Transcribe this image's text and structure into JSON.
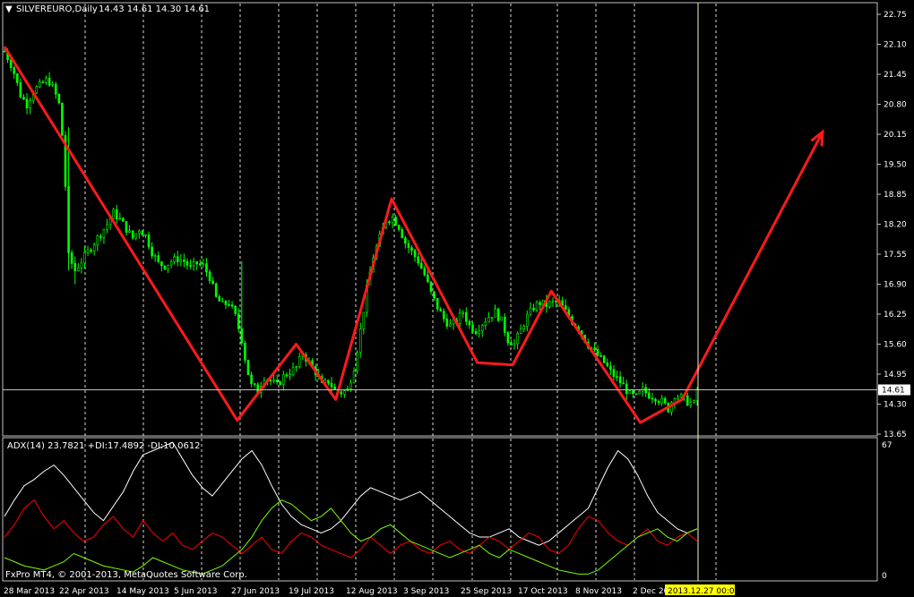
{
  "chart_data": [
    {
      "type": "candlestick",
      "symbol_label": "SILVEREURO,Daily",
      "ohlc_label": "14.43 14.61 14.30 14.61",
      "ylim": [
        13.65,
        22.75
      ],
      "y_ticks": [
        "22.75",
        "22.10",
        "21.45",
        "20.80",
        "20.15",
        "19.50",
        "18.85",
        "18.20",
        "17.55",
        "16.90",
        "16.25",
        "15.60",
        "14.95",
        "14.30",
        "13.65"
      ],
      "current_price": "14.61",
      "x_labels": [
        "28 Mar 2013",
        "22 Apr 2013",
        "14 May 2013",
        "5 Jun 2013",
        "27 Jun 2013",
        "19 Jul 2013",
        "12 Aug 2013",
        "3 Sep 2013",
        "25 Sep 2013",
        "17 Oct 2013",
        "8 Nov 2013",
        "2 Dec 2013"
      ],
      "cursor_label": "2013.12.27 00:00",
      "price_path": [
        [
          0,
          21.95
        ],
        [
          5,
          21.6
        ],
        [
          10,
          21.0
        ],
        [
          14,
          20.8
        ],
        [
          18,
          21.1
        ],
        [
          22,
          21.2
        ],
        [
          27,
          21.35
        ],
        [
          31,
          21.1
        ],
        [
          34,
          20.8
        ],
        [
          37,
          19.8
        ],
        [
          40,
          17.5
        ],
        [
          44,
          17.2
        ],
        [
          48,
          17.4
        ],
        [
          52,
          17.6
        ],
        [
          56,
          17.8
        ],
        [
          60,
          18.0
        ],
        [
          64,
          18.2
        ],
        [
          68,
          18.45
        ],
        [
          72,
          18.3
        ],
        [
          76,
          18.1
        ],
        [
          80,
          17.9
        ],
        [
          84,
          18.1
        ],
        [
          88,
          17.95
        ],
        [
          92,
          17.6
        ],
        [
          96,
          17.35
        ],
        [
          100,
          17.3
        ],
        [
          104,
          17.4
        ],
        [
          108,
          17.45
        ],
        [
          112,
          17.4
        ],
        [
          116,
          17.25
        ],
        [
          120,
          17.35
        ],
        [
          124,
          17.3
        ],
        [
          128,
          17.05
        ],
        [
          132,
          16.6
        ],
        [
          136,
          16.45
        ],
        [
          140,
          16.5
        ],
        [
          144,
          16.2
        ],
        [
          148,
          15.7
        ],
        [
          151,
          15.1
        ],
        [
          154,
          14.7
        ],
        [
          158,
          14.6
        ],
        [
          162,
          14.9
        ],
        [
          166,
          14.8
        ],
        [
          170,
          14.7
        ],
        [
          174,
          14.9
        ],
        [
          178,
          15.0
        ],
        [
          182,
          15.1
        ],
        [
          186,
          15.4
        ],
        [
          190,
          15.2
        ],
        [
          194,
          15.0
        ],
        [
          198,
          14.7
        ],
        [
          202,
          14.8
        ],
        [
          206,
          14.6
        ],
        [
          210,
          14.55
        ],
        [
          214,
          14.6
        ],
        [
          218,
          15.1
        ],
        [
          222,
          15.9
        ],
        [
          226,
          16.8
        ],
        [
          230,
          17.5
        ],
        [
          234,
          17.9
        ],
        [
          238,
          18.3
        ],
        [
          242,
          18.35
        ],
        [
          246,
          18.15
        ],
        [
          250,
          17.8
        ],
        [
          254,
          17.6
        ],
        [
          258,
          17.4
        ],
        [
          262,
          17.1
        ],
        [
          266,
          16.7
        ],
        [
          270,
          16.4
        ],
        [
          274,
          16.15
        ],
        [
          278,
          16.0
        ],
        [
          282,
          16.1
        ],
        [
          286,
          16.3
        ],
        [
          290,
          16.0
        ],
        [
          294,
          15.9
        ],
        [
          298,
          16.05
        ],
        [
          302,
          16.2
        ],
        [
          306,
          16.3
        ],
        [
          310,
          16.1
        ],
        [
          314,
          15.7
        ],
        [
          318,
          15.6
        ],
        [
          322,
          15.9
        ],
        [
          326,
          16.2
        ],
        [
          330,
          16.4
        ],
        [
          334,
          16.5
        ],
        [
          338,
          16.45
        ],
        [
          342,
          16.5
        ],
        [
          346,
          16.5
        ],
        [
          350,
          16.3
        ],
        [
          354,
          16.1
        ],
        [
          358,
          15.95
        ],
        [
          362,
          15.7
        ],
        [
          366,
          15.5
        ],
        [
          370,
          15.35
        ],
        [
          374,
          15.2
        ],
        [
          378,
          15.0
        ],
        [
          382,
          14.85
        ],
        [
          386,
          14.7
        ],
        [
          390,
          14.5
        ],
        [
          394,
          14.45
        ],
        [
          398,
          14.6
        ],
        [
          402,
          14.5
        ],
        [
          406,
          14.45
        ],
        [
          410,
          14.35
        ],
        [
          414,
          14.2
        ],
        [
          418,
          14.5
        ],
        [
          422,
          14.45
        ],
        [
          426,
          14.35
        ],
        [
          430,
          14.3
        ],
        [
          432,
          14.61
        ]
      ],
      "price_path_x_range": [
        0,
        432
      ],
      "zigzag": [
        [
          0,
          22.05
        ],
        [
          217,
          13.95
        ],
        [
          272,
          15.6
        ],
        [
          309,
          14.4
        ],
        [
          361,
          18.75
        ],
        [
          441,
          15.2
        ],
        [
          474,
          15.15
        ],
        [
          510,
          16.75
        ],
        [
          593,
          13.9
        ],
        [
          632,
          14.4
        ],
        [
          763,
          20.2
        ]
      ],
      "zigzag_x_range": [
        0,
        763
      ]
    },
    {
      "type": "line",
      "label": "ADX(14) 23.7821 +DI:17.4892 -DI:10.0612",
      "ylim": [
        0,
        67
      ],
      "y_ticks": [
        "67",
        "0"
      ],
      "series": [
        {
          "color": "#ffffff",
          "values": [
            30,
            38,
            45,
            48,
            52,
            55,
            50,
            44,
            38,
            32,
            28,
            35,
            42,
            52,
            60,
            62,
            64,
            66,
            58,
            50,
            44,
            40,
            46,
            52,
            58,
            62,
            55,
            45,
            36,
            30,
            26,
            24,
            22,
            24,
            28,
            34,
            40,
            44,
            42,
            40,
            38,
            40,
            42,
            38,
            34,
            30,
            26,
            22,
            20,
            20,
            22,
            24,
            20,
            18,
            16,
            18,
            22,
            26,
            30,
            34,
            44,
            54,
            62,
            58,
            50,
            40,
            32,
            28,
            24,
            22,
            24
          ]
        },
        {
          "color": "#ff0000",
          "values": [
            20,
            26,
            34,
            38,
            30,
            24,
            28,
            22,
            18,
            20,
            26,
            30,
            24,
            20,
            28,
            22,
            18,
            22,
            16,
            14,
            18,
            22,
            20,
            16,
            12,
            16,
            20,
            14,
            12,
            18,
            22,
            20,
            16,
            14,
            12,
            10,
            14,
            20,
            16,
            12,
            16,
            18,
            14,
            12,
            16,
            18,
            14,
            12,
            16,
            20,
            18,
            14,
            18,
            22,
            20,
            14,
            12,
            16,
            24,
            30,
            28,
            22,
            18,
            16,
            20,
            24,
            18,
            16,
            20,
            22,
            18
          ]
        },
        {
          "color": "#7cfc00",
          "values": [
            10,
            8,
            6,
            5,
            4,
            6,
            8,
            12,
            10,
            8,
            6,
            5,
            4,
            3,
            6,
            10,
            8,
            6,
            4,
            3,
            2,
            4,
            6,
            10,
            14,
            20,
            28,
            34,
            38,
            36,
            32,
            28,
            30,
            34,
            28,
            22,
            18,
            20,
            24,
            26,
            22,
            18,
            16,
            14,
            12,
            10,
            12,
            14,
            16,
            12,
            10,
            14,
            12,
            10,
            8,
            6,
            4,
            3,
            2,
            2,
            4,
            8,
            12,
            16,
            20,
            22,
            24,
            20,
            18,
            22,
            24
          ]
        }
      ]
    }
  ],
  "footer": {
    "copyright": "FxPro MT4, © 2001-2013, MetaQuotes Software Corp."
  }
}
